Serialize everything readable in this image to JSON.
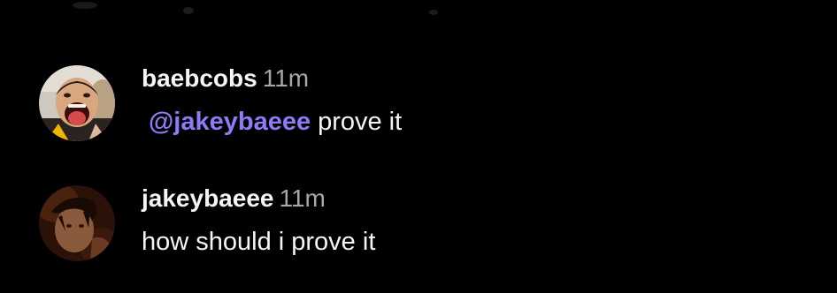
{
  "comments": [
    {
      "username": "baebcobs",
      "time": "11m",
      "mention": "@jakeybaeee",
      "text": "prove it",
      "avatar_icon": "laughing-face-avatar"
    },
    {
      "username": "jakeybaeee",
      "time": "11m",
      "text": "how should i prove it",
      "avatar_icon": "dark-portrait-avatar"
    }
  ],
  "colors": {
    "background": "#000000",
    "text": "#f5f5f5",
    "timestamp": "#a8a8a8",
    "mention": "#8e7cf6"
  }
}
